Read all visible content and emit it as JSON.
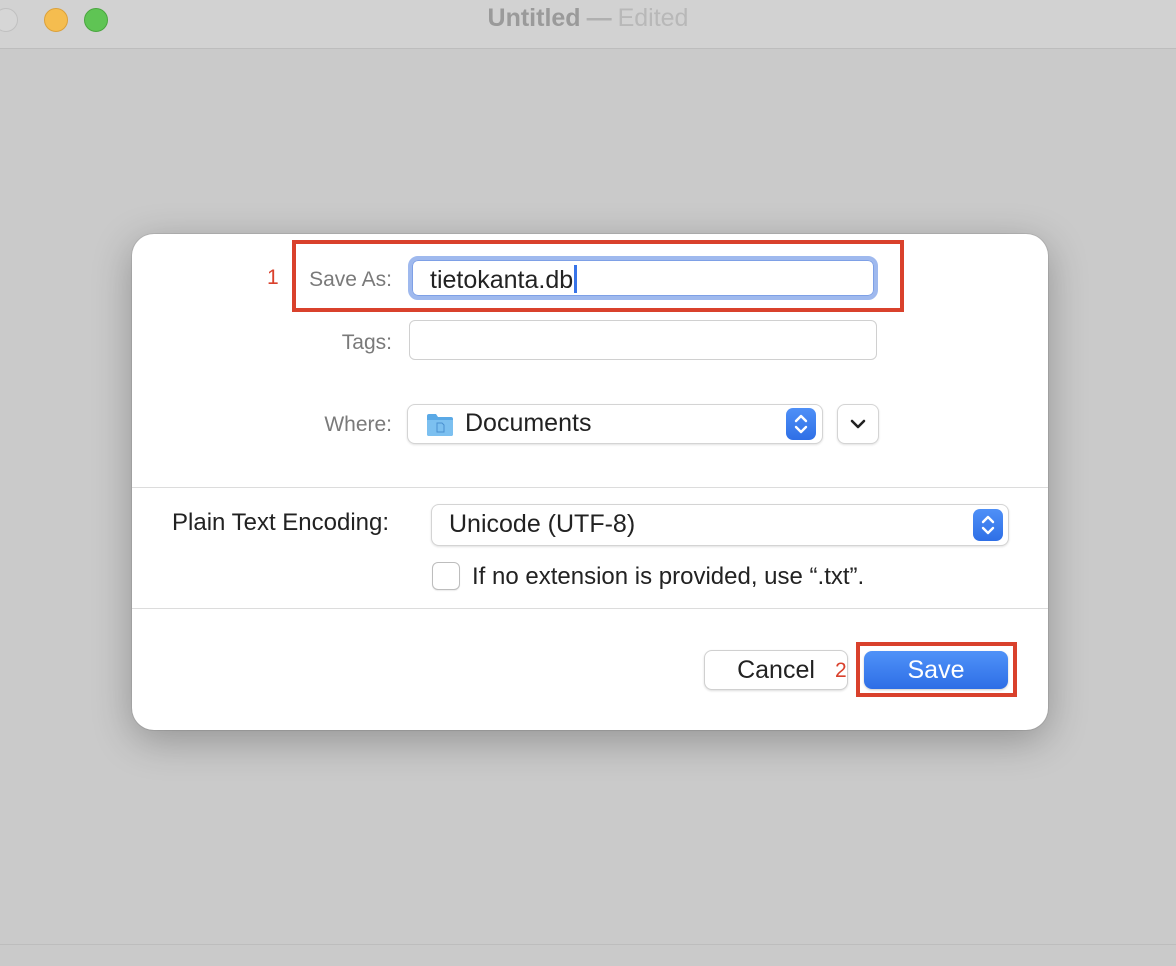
{
  "window": {
    "title": "Untitled",
    "separator": "—",
    "status": "Edited"
  },
  "dialog": {
    "save_as_label": "Save As:",
    "save_as_value": "tietokanta.db",
    "tags_label": "Tags:",
    "tags_value": "",
    "where_label": "Where:",
    "where_value": "Documents",
    "encoding_label": "Plain Text Encoding:",
    "encoding_value": "Unicode (UTF-8)",
    "extension_checkbox_label": "If no extension is provided, use “.txt”.",
    "extension_checkbox_checked": false,
    "cancel_label": "Cancel",
    "save_label": "Save"
  },
  "annotations": {
    "marker_1": "1",
    "marker_2": "2",
    "color": "#d9412c"
  },
  "icons": {
    "folder": "folder-icon",
    "stepper": "up-down-chevron-icon",
    "expand": "chevron-down-icon"
  },
  "colors": {
    "accent": "#3478f6",
    "focus_ring": "#9fb9ee",
    "window_bg": "#cacaca"
  }
}
